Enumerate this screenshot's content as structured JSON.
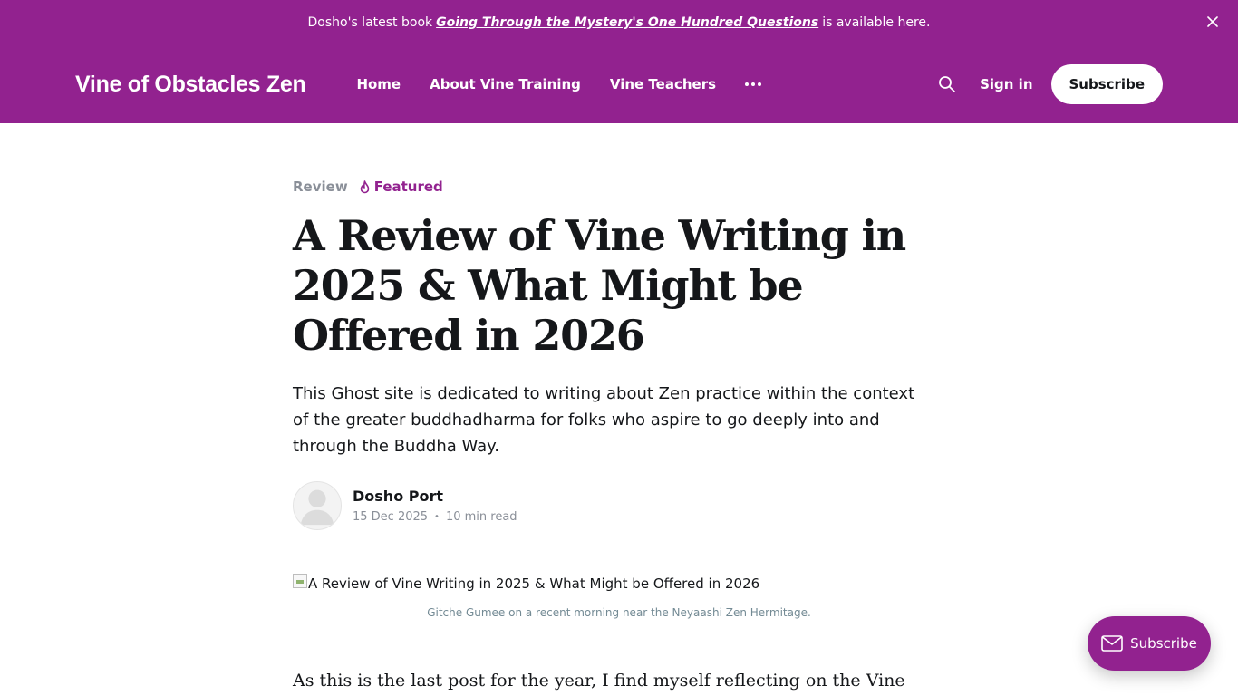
{
  "announcement": {
    "prefix": "Dosho's latest book",
    "link_text": "Going Through the Mystery's One Hundred Questions",
    "suffix": "is available here."
  },
  "header": {
    "logo": "Vine of Obstacles Zen",
    "nav": [
      {
        "label": "Home"
      },
      {
        "label": "About Vine Training"
      },
      {
        "label": "Vine Teachers"
      }
    ],
    "sign_in": "Sign in",
    "subscribe": "Subscribe"
  },
  "post": {
    "tag": "Review",
    "featured": "Featured",
    "title": "A Review of Vine Writing in 2025 & What Might be Offered in 2026",
    "excerpt": "This Ghost site is dedicated to writing about Zen practice within the context of the greater buddhadharma for folks who aspire to go deeply into and through the Buddha Way.",
    "author": "Dosho Port",
    "date": "15 Dec 2025",
    "read_time": "10 min read",
    "feature_image_alt": "A Review of Vine Writing in 2025 & What Might be Offered in 2026",
    "caption": "Gitche Gumee on a recent morning near the Neyaashi Zen Hermitage.",
    "body_start": "As this is the last post for the year, I find myself reflecting on the Vine of"
  },
  "portal": {
    "label": "Subscribe"
  },
  "colors": {
    "brand": "#92228f",
    "text": "#15171a",
    "muted": "#8a8f98"
  },
  "icons": [
    "close-icon",
    "search-icon",
    "more-dots-icon",
    "fire-icon",
    "avatar-placeholder-icon",
    "broken-image-icon",
    "mail-icon"
  ]
}
